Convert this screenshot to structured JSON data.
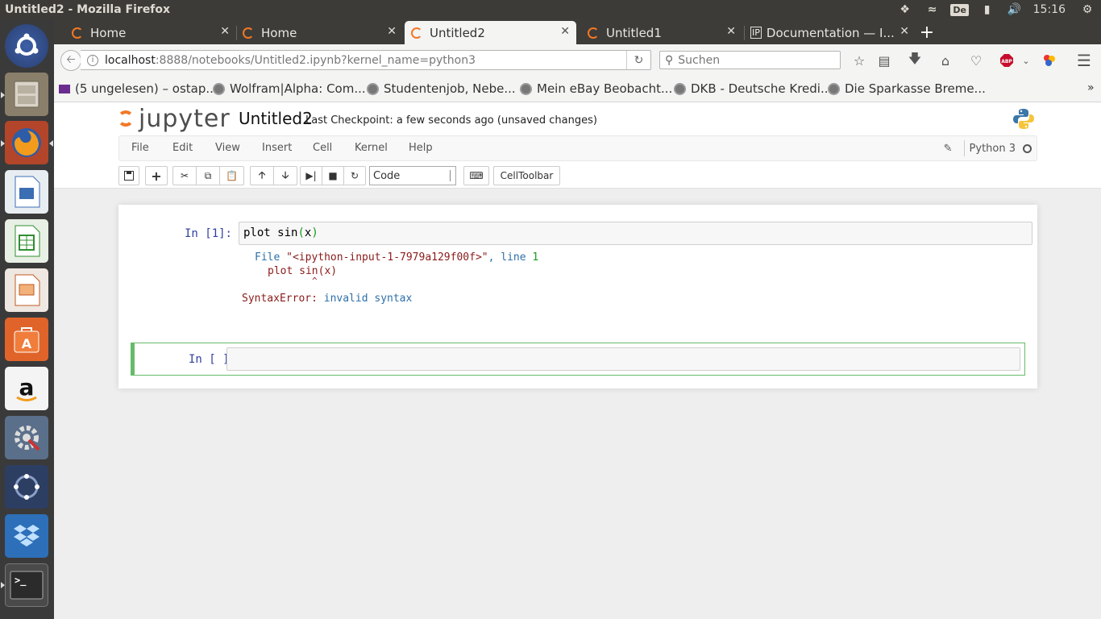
{
  "window": {
    "title": "Untitled2 - Mozilla Firefox"
  },
  "tray": {
    "keyboard": "De",
    "clock": "15:16"
  },
  "tabs": [
    {
      "label": "Home"
    },
    {
      "label": "Home"
    },
    {
      "label": "Untitled2"
    },
    {
      "label": "Untitled1"
    },
    {
      "label": "Documentation — I..."
    }
  ],
  "nav": {
    "url_host": "localhost",
    "url_path": ":8888/notebooks/Untitled2.ipynb?kernel_name=python3",
    "search_placeholder": "Suchen"
  },
  "bookmarks": [
    {
      "label": "(5 ungelesen) – ostap..."
    },
    {
      "label": "Wolfram|Alpha: Com..."
    },
    {
      "label": "Studentenjob, Nebe..."
    },
    {
      "label": "Mein eBay Beobacht..."
    },
    {
      "label": "DKB - Deutsche Kredi..."
    },
    {
      "label": "Die Sparkasse Breme..."
    }
  ],
  "jupyter": {
    "logo_text": "jupyter",
    "notebook_name": "Untitled2",
    "checkpoint": "Last Checkpoint: a few seconds ago (unsaved changes)",
    "menu": [
      "File",
      "Edit",
      "View",
      "Insert",
      "Cell",
      "Kernel",
      "Help"
    ],
    "kernel_name": "Python 3",
    "cell_type": "Code",
    "celltoolbar_label": "CellToolbar"
  },
  "cells": [
    {
      "prompt": "In [1]:",
      "source_fn": "plot sin",
      "source_paren_open": "(",
      "source_arg": "x",
      "source_paren_close": ")",
      "tb_file_kw": "File",
      "tb_file_str": "\"<ipython-input-1-7979a129f00f>\"",
      "tb_line_kw": ", line",
      "tb_line_no": "1",
      "tb_code": "plot sin(x)",
      "tb_caret": "^",
      "err_name": "SyntaxError:",
      "err_msg": "invalid syntax"
    },
    {
      "prompt": "In [ ]:",
      "source": ""
    }
  ]
}
